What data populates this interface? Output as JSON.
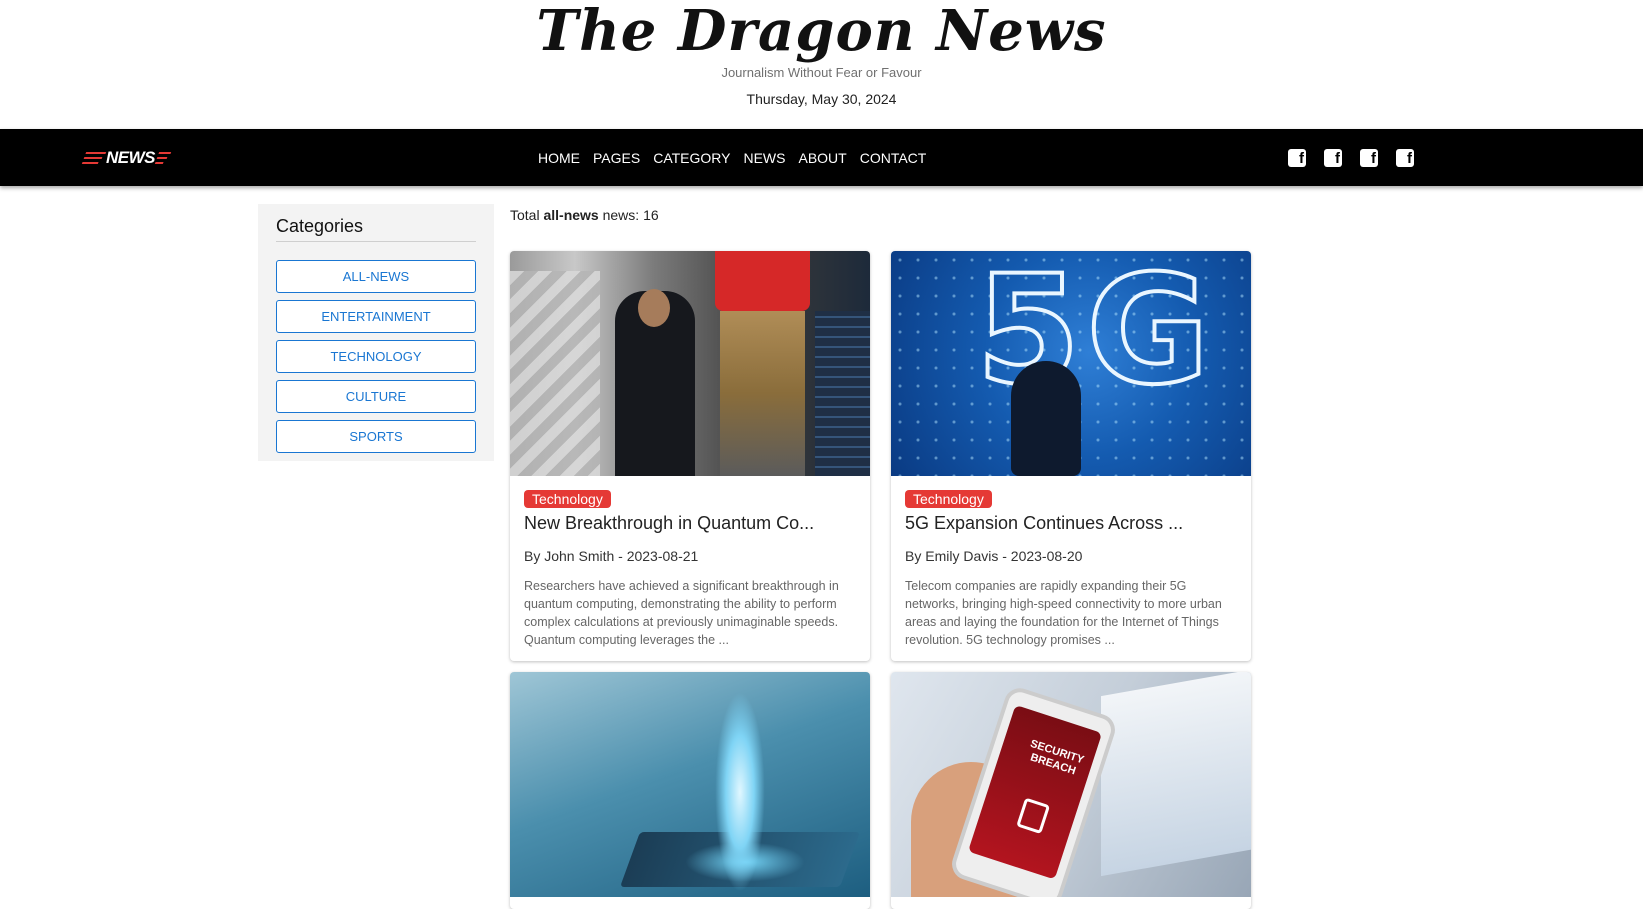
{
  "site": {
    "title": "The Dragon News",
    "tagline": "Journalism Without Fear or Favour",
    "date": "Thursday, May 30, 2024"
  },
  "navbar": {
    "logo_text": "NEWS",
    "links": [
      "HOME",
      "PAGES",
      "CATEGORY",
      "NEWS",
      "ABOUT",
      "CONTACT"
    ],
    "social_icons": [
      "facebook-icon",
      "facebook-icon",
      "facebook-icon",
      "facebook-icon"
    ]
  },
  "sidebar": {
    "heading": "Categories",
    "categories": [
      "ALL-NEWS",
      "ENTERTAINMENT",
      "TECHNOLOGY",
      "CULTURE",
      "SPORTS"
    ]
  },
  "summary": {
    "prefix": "Total",
    "category": "all-news",
    "suffix": "news: 16"
  },
  "cards": [
    {
      "badge": "Technology",
      "headline": "New Breakthrough in Quantum Co...",
      "byline": "By John Smith - 2023-08-21",
      "excerpt": "Researchers have achieved a significant breakthrough in quantum computing, demonstrating the ability to perform complex calculations at previously unimaginable speeds. Quantum computing leverages the ..."
    },
    {
      "badge": "Technology",
      "headline": "5G Expansion Continues Across ...",
      "byline": "By Emily Davis - 2023-08-20",
      "excerpt": "Telecom companies are rapidly expanding their 5G networks, bringing high-speed connectivity to more urban areas and laying the foundation for the Internet of Things revolution. 5G technology promises ..."
    },
    {
      "image_text": ""
    },
    {
      "image_text": "SECURITY BREACH"
    }
  ],
  "image_labels": {
    "fiveg": "5G"
  },
  "colors": {
    "accent": "#e53935",
    "link": "#1976d2",
    "navbar": "#000000"
  }
}
